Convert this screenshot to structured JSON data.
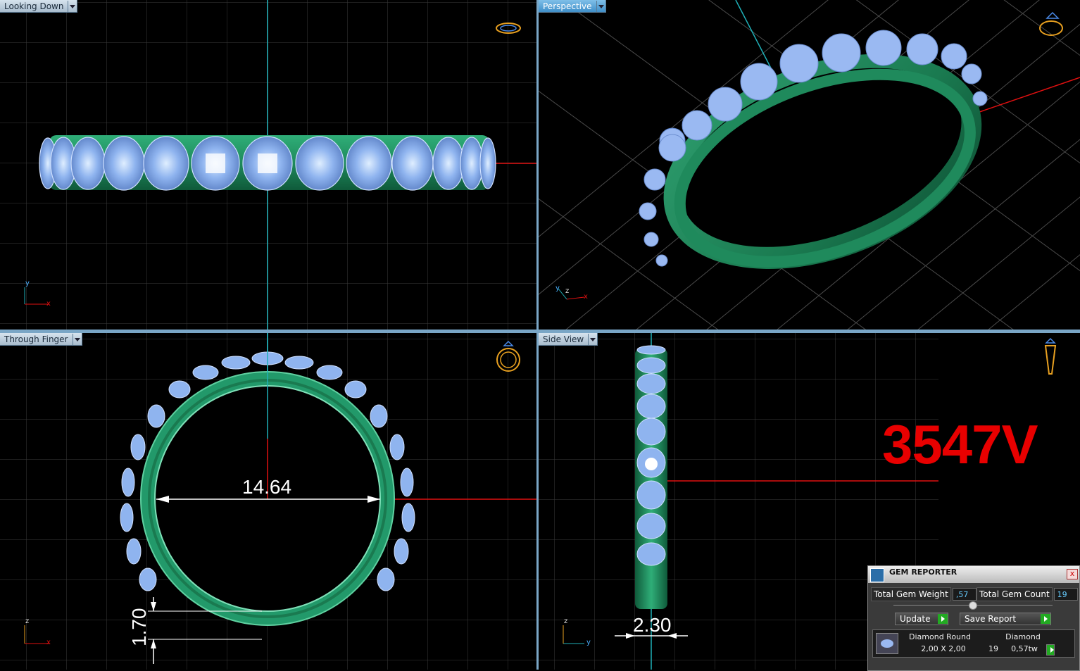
{
  "viewports": {
    "top_left": {
      "label": "Looking Down"
    },
    "top_right": {
      "label": "Perspective"
    },
    "bottom_left": {
      "label": "Through Finger"
    },
    "bottom_right": {
      "label": "Side View"
    }
  },
  "dimensions": {
    "inner_diameter": "14.64",
    "band_thickness": "1.70",
    "band_width": "2.30"
  },
  "model_code": "3547V",
  "axes": {
    "x": "x",
    "y": "y",
    "z": "z"
  },
  "gem_reporter": {
    "title": "GEM REPORTER",
    "close": "x",
    "total_weight_label": "Total Gem Weight",
    "total_weight_value": ",57",
    "total_count_label": "Total Gem Count",
    "total_count_value": "19",
    "update_label": "Update",
    "save_label": "Save Report",
    "row": {
      "col1_header": "Diamond Round",
      "col2_header": "Diamond",
      "size": "2,00 X 2,00",
      "count": "19",
      "weight": "0,57tw"
    }
  },
  "colors": {
    "metal": "#1f8a5c",
    "gem": "#8fb4ef",
    "axis_red": "#e01010",
    "axis_cyan": "#1fb0b8",
    "grid": "#4a4a4a",
    "code_red": "#e80000"
  }
}
